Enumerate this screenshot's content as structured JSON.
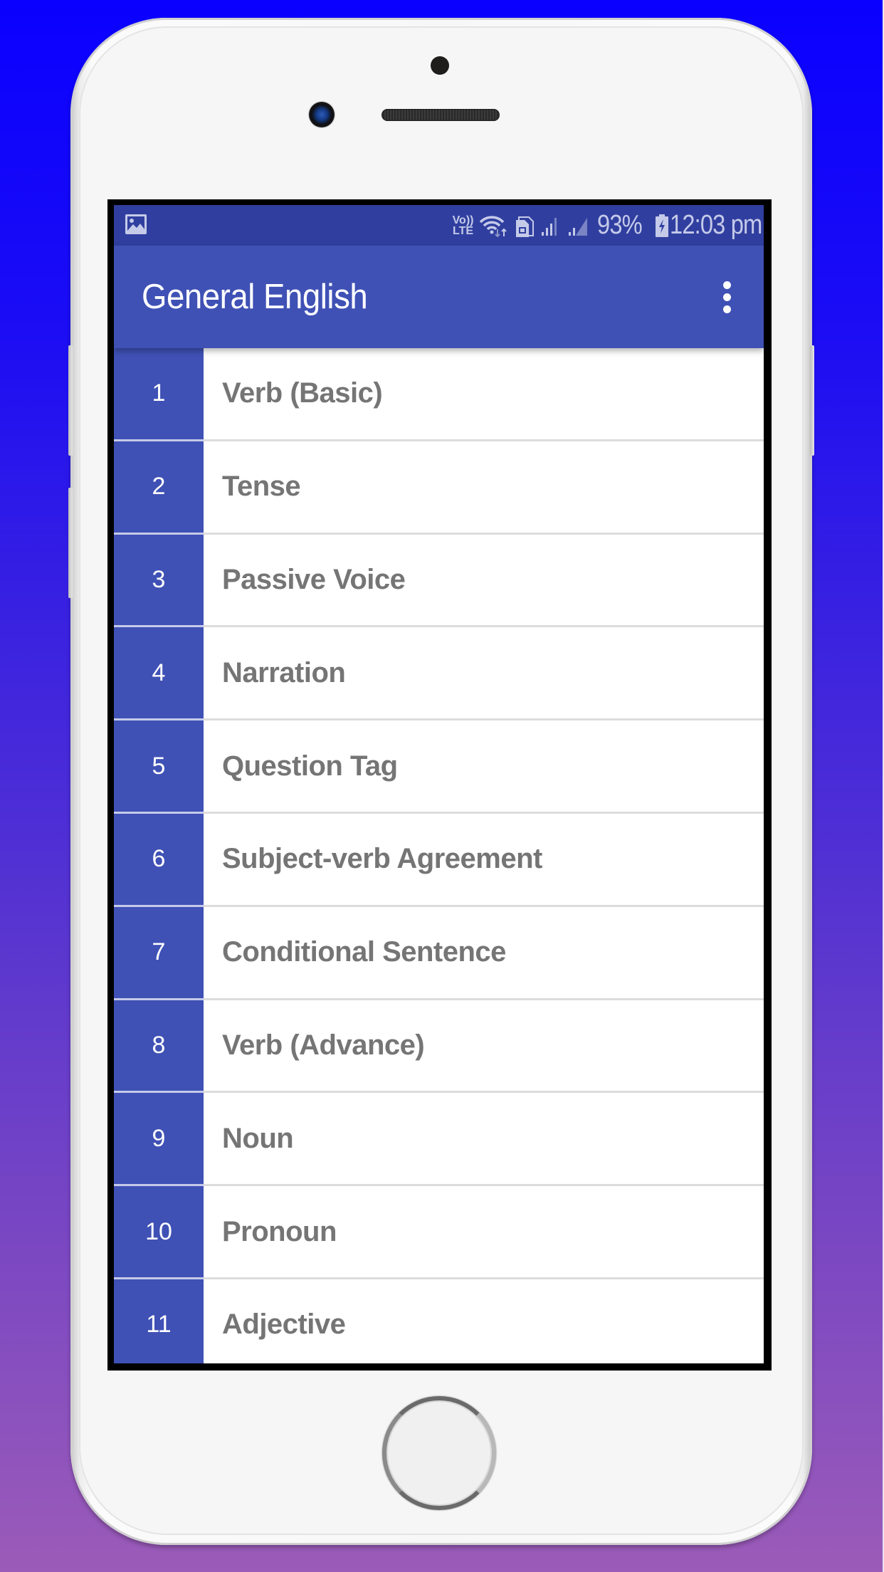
{
  "colors": {
    "background_top": "#0a00ff",
    "background_bottom": "#9b5bb8",
    "primary": "#3f51b5",
    "primary_dark": "#303f9f",
    "label_text": "#757575"
  },
  "status_bar": {
    "notification_icon": "image-icon",
    "network_label_top": "Vo))",
    "network_label_bottom": "LTE",
    "icons": [
      "volte-icon",
      "wifi-icon",
      "sim-icon",
      "signal-icon",
      "signal-icon",
      "battery-charging-icon"
    ],
    "battery_percent": "93%",
    "time": "12:03 pm"
  },
  "toolbar": {
    "title": "General English",
    "overflow_icon": "more-vert-icon"
  },
  "topics": [
    {
      "number": "1",
      "label": "Verb (Basic)"
    },
    {
      "number": "2",
      "label": "Tense"
    },
    {
      "number": "3",
      "label": "Passive Voice"
    },
    {
      "number": "4",
      "label": "Narration"
    },
    {
      "number": "5",
      "label": "Question Tag"
    },
    {
      "number": "6",
      "label": "Subject-verb Agreement"
    },
    {
      "number": "7",
      "label": "Conditional Sentence"
    },
    {
      "number": "8",
      "label": "Verb (Advance)"
    },
    {
      "number": "9",
      "label": "Noun"
    },
    {
      "number": "10",
      "label": "Pronoun"
    },
    {
      "number": "11",
      "label": "Adjective"
    }
  ]
}
